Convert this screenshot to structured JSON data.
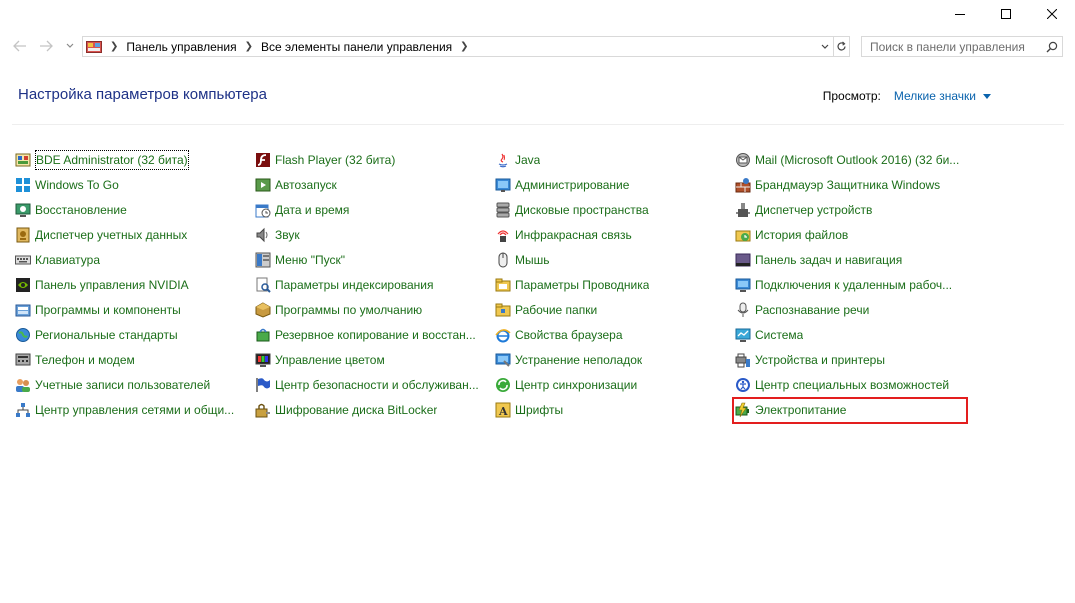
{
  "window": {
    "minimize_icon": "minimize-icon",
    "maximize_icon": "maximize-icon",
    "close_icon": "close-icon"
  },
  "nav": {
    "back_icon": "arrow-left-icon",
    "forward_icon": "arrow-right-icon",
    "recent_icon": "chevron-down-icon",
    "breadcrumb": [
      "Панель управления",
      "Все элементы панели управления"
    ],
    "search_placeholder": "Поиск в панели управления"
  },
  "header": {
    "title": "Настройка параметров компьютера",
    "view_label": "Просмотр:",
    "view_value": "Мелкие значки"
  },
  "colors": {
    "link": "#1b6e19",
    "title": "#1e3287",
    "accent": "#0a63ad",
    "highlight": "#e31e1e"
  },
  "columns": [
    [
      {
        "label": "BDE Administrator (32 бита)",
        "icon": "bde-admin-icon"
      },
      {
        "label": "Windows To Go",
        "icon": "windows-to-go-icon"
      },
      {
        "label": "Восстановление",
        "icon": "recovery-icon"
      },
      {
        "label": "Диспетчер учетных данных",
        "icon": "credential-manager-icon"
      },
      {
        "label": "Клавиатура",
        "icon": "keyboard-icon"
      },
      {
        "label": "Панель управления NVIDIA",
        "icon": "nvidia-icon"
      },
      {
        "label": "Программы и компоненты",
        "icon": "programs-icon"
      },
      {
        "label": "Региональные стандарты",
        "icon": "region-icon"
      },
      {
        "label": "Телефон и модем",
        "icon": "phone-modem-icon"
      },
      {
        "label": "Учетные записи пользователей",
        "icon": "user-accounts-icon"
      },
      {
        "label": "Центр управления сетями и общи...",
        "icon": "network-center-icon"
      }
    ],
    [
      {
        "label": "Flash Player (32 бита)",
        "icon": "flash-player-icon"
      },
      {
        "label": "Автозапуск",
        "icon": "autoplay-icon"
      },
      {
        "label": "Дата и время",
        "icon": "date-time-icon"
      },
      {
        "label": "Звук",
        "icon": "sound-icon"
      },
      {
        "label": "Меню \"Пуск\"",
        "icon": "start-menu-icon"
      },
      {
        "label": "Параметры индексирования",
        "icon": "indexing-icon"
      },
      {
        "label": "Программы по умолчанию",
        "icon": "default-programs-icon"
      },
      {
        "label": "Резервное копирование и восстан...",
        "icon": "backup-icon"
      },
      {
        "label": "Управление цветом",
        "icon": "color-management-icon"
      },
      {
        "label": "Центр безопасности и обслуживан...",
        "icon": "security-flag-icon"
      },
      {
        "label": "Шифрование диска BitLocker",
        "icon": "bitlocker-icon"
      }
    ],
    [
      {
        "label": "Java",
        "icon": "java-icon"
      },
      {
        "label": "Администрирование",
        "icon": "admin-tools-icon"
      },
      {
        "label": "Дисковые пространства",
        "icon": "storage-spaces-icon"
      },
      {
        "label": "Инфракрасная связь",
        "icon": "infrared-icon"
      },
      {
        "label": "Мышь",
        "icon": "mouse-icon"
      },
      {
        "label": "Параметры Проводника",
        "icon": "explorer-options-icon"
      },
      {
        "label": "Рабочие папки",
        "icon": "work-folders-icon"
      },
      {
        "label": "Свойства браузера",
        "icon": "internet-options-icon"
      },
      {
        "label": "Устранение неполадок",
        "icon": "troubleshoot-icon"
      },
      {
        "label": "Центр синхронизации",
        "icon": "sync-center-icon"
      },
      {
        "label": "Шрифты",
        "icon": "fonts-icon"
      }
    ],
    [
      {
        "label": "Mail (Microsoft Outlook 2016) (32 би...",
        "icon": "mail-icon"
      },
      {
        "label": "Брандмауэр Защитника Windows",
        "icon": "firewall-icon"
      },
      {
        "label": "Диспетчер устройств",
        "icon": "device-manager-icon"
      },
      {
        "label": "История файлов",
        "icon": "file-history-icon"
      },
      {
        "label": "Панель задач и навигация",
        "icon": "taskbar-icon"
      },
      {
        "label": "Подключения к удаленным рабоч...",
        "icon": "remote-desktop-icon"
      },
      {
        "label": "Распознавание речи",
        "icon": "speech-icon"
      },
      {
        "label": "Система",
        "icon": "system-icon"
      },
      {
        "label": "Устройства и принтеры",
        "icon": "devices-printers-icon"
      },
      {
        "label": "Центр специальных возможностей",
        "icon": "ease-of-access-icon"
      },
      {
        "label": "Электропитание",
        "icon": "power-options-icon"
      }
    ]
  ]
}
